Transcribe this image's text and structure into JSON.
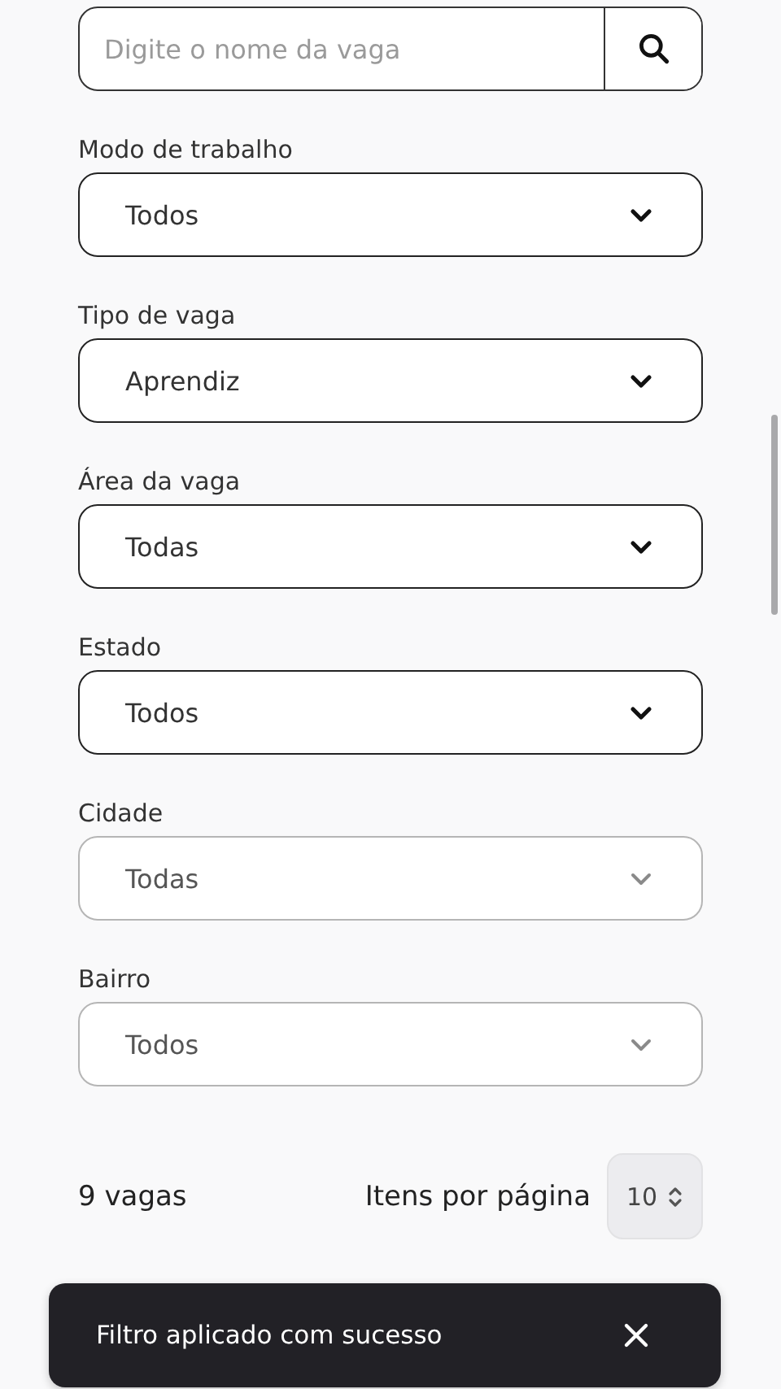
{
  "search": {
    "placeholder": "Digite o nome da vaga"
  },
  "filters": [
    {
      "label": "Modo de trabalho",
      "value": "Todos",
      "disabled": false
    },
    {
      "label": "Tipo de vaga",
      "value": "Aprendiz",
      "disabled": false
    },
    {
      "label": "Área da vaga",
      "value": "Todas",
      "disabled": false
    },
    {
      "label": "Estado",
      "value": "Todos",
      "disabled": false
    },
    {
      "label": "Cidade",
      "value": "Todas",
      "disabled": true
    },
    {
      "label": "Bairro",
      "value": "Todos",
      "disabled": true
    }
  ],
  "results": {
    "count": "9 vagas",
    "per_page_label": "Itens por página",
    "per_page": "10"
  },
  "toast": {
    "message": "Filtro aplicado com sucesso"
  }
}
